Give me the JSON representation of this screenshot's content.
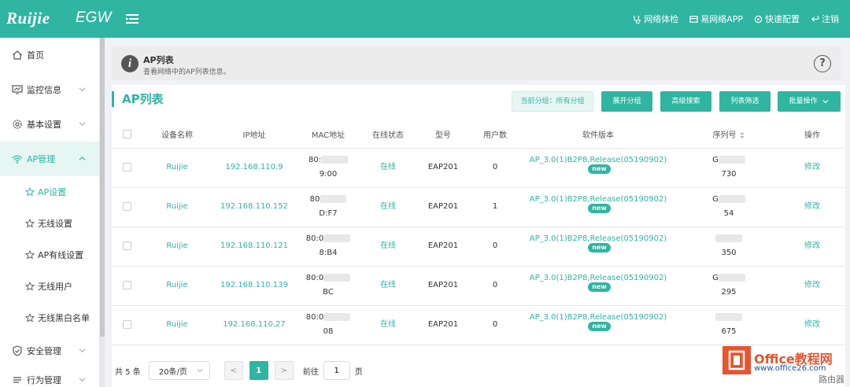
{
  "header": {
    "logo": "Ruijie",
    "product": "EGW",
    "links": [
      {
        "label": "网络体检",
        "icon": "stethoscope-icon"
      },
      {
        "label": "易网络APP",
        "icon": "app-icon"
      },
      {
        "label": "快速配置",
        "icon": "gear-icon"
      },
      {
        "label": "注销",
        "icon": "logout-icon"
      }
    ]
  },
  "sidebar": {
    "items": [
      {
        "label": "首页",
        "icon": "home-icon"
      },
      {
        "label": "监控信息",
        "icon": "monitor-icon"
      },
      {
        "label": "基本设置",
        "icon": "gear-icon"
      },
      {
        "label": "AP管理",
        "icon": "wifi-icon"
      },
      {
        "label": "安全管理",
        "icon": "shield-icon"
      },
      {
        "label": "行为管理",
        "icon": "behavior-icon"
      }
    ],
    "sub_items": [
      {
        "label": "AP设置"
      },
      {
        "label": "无线设置"
      },
      {
        "label": "AP有线设置"
      },
      {
        "label": "无线用户"
      },
      {
        "label": "无线黑白名单"
      }
    ]
  },
  "info_bar": {
    "title": "AP列表",
    "description": "查看网络中的AP列表信息。",
    "help": "?"
  },
  "panel": {
    "title": "AP列表",
    "group_tag": "当前分组：所有分组",
    "buttons": {
      "expand": "展开分组",
      "advanced_search": "高级搜索",
      "filter": "列表筛选",
      "batch": "批量操作"
    }
  },
  "table": {
    "columns": [
      "设备名称",
      "IP地址",
      "MAC地址",
      "在线状态",
      "型号",
      "用户数",
      "软件版本",
      "序列号",
      "操作"
    ],
    "rows": [
      {
        "name": "Ruijie",
        "ip": "192.168.110.9",
        "mac1": "80:",
        "mac2": "9:00",
        "status": "在线",
        "model": "EAP201",
        "users": "0",
        "version": "AP_3.0(1)B2P8,Release(05190902)",
        "badge": "new",
        "serial1": "G",
        "serial2": "730",
        "action": "修改"
      },
      {
        "name": "Ruijie",
        "ip": "192.168.110.152",
        "mac1": "80",
        "mac2": "D:F7",
        "status": "在线",
        "model": "EAP201",
        "users": "1",
        "version": "AP_3.0(1)B2P8,Release(05190902)",
        "badge": "new",
        "serial1": "G",
        "serial2": "54",
        "action": "修改"
      },
      {
        "name": "Ruijie",
        "ip": "192.168.110.121",
        "mac1": "80:0",
        "mac2": "8:B4",
        "status": "在线",
        "model": "EAP201",
        "users": "0",
        "version": "AP_3.0(1)B2P8,Release(05190902)",
        "badge": "new",
        "serial1": "",
        "serial2": "350",
        "action": "修改"
      },
      {
        "name": "Ruijie",
        "ip": "192.168.110.139",
        "mac1": "80:0",
        "mac2": "BC",
        "status": "在线",
        "model": "EAP201",
        "users": "0",
        "version": "AP_3.0(1)B2P8,Release(05190902)",
        "badge": "new",
        "serial1": "G",
        "serial2": "295",
        "action": "修改"
      },
      {
        "name": "Ruijie",
        "ip": "192.168.110.27",
        "mac1": "80:0",
        "mac2": "08",
        "status": "在线",
        "model": "EAP201",
        "users": "0",
        "version": "AP_3.0(1)B2P8,Release(05190902)",
        "badge": "new",
        "serial1": "",
        "serial2": "675",
        "action": "修改"
      }
    ]
  },
  "pagination": {
    "total": "共 5 条",
    "page_size": "20条/页",
    "prev": "<",
    "current": "1",
    "next": ">",
    "goto_label": "前往",
    "goto_value": "1",
    "page_suffix": "页"
  },
  "watermark": {
    "title": "Office教程网",
    "url": "www.office26.com",
    "site": "路由器"
  },
  "colors": {
    "accent": "#2fb5a2",
    "watermark": "#e8542b"
  }
}
